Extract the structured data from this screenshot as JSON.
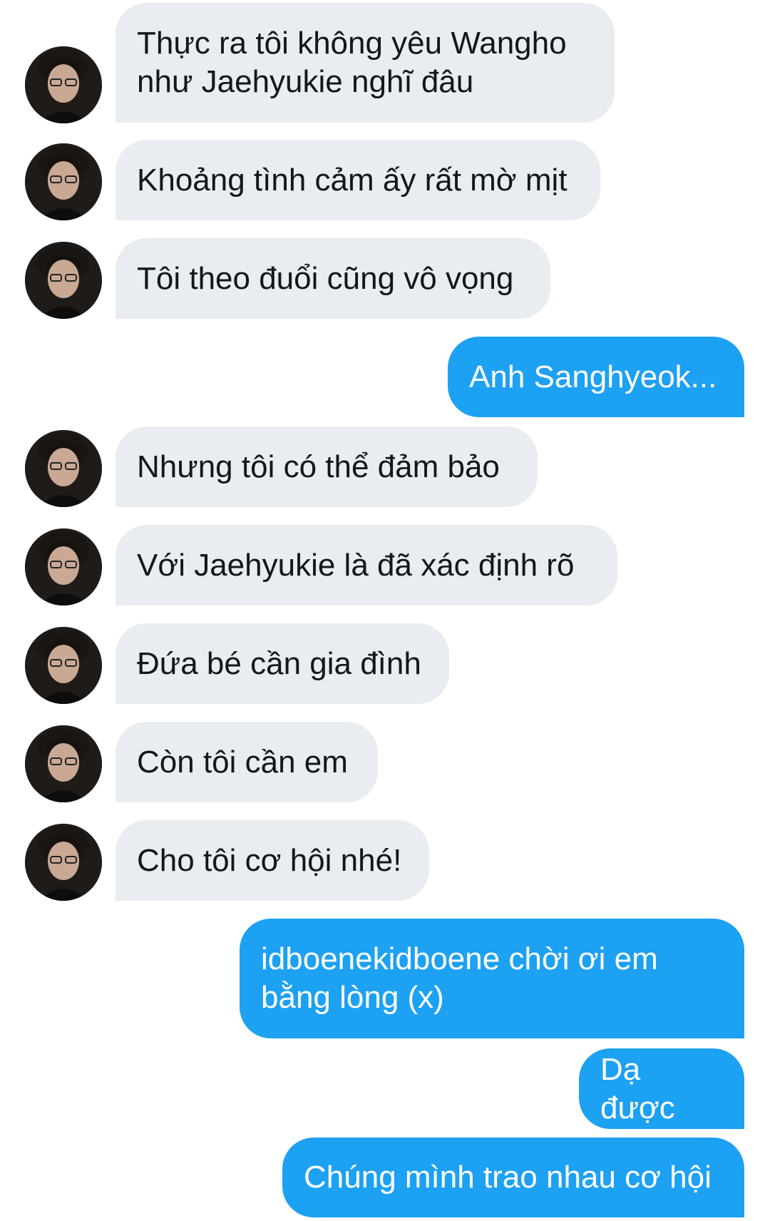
{
  "conversation": {
    "messages": [
      {
        "side": "in",
        "text": "Thực ra tôi không yêu Wangho\nnhư Jaehyukie nghĩ đâu"
      },
      {
        "side": "in",
        "text": "Khoảng tình cảm ấy rất mờ mịt"
      },
      {
        "side": "in",
        "text": "Tôi theo đuổi cũng vô vọng"
      },
      {
        "side": "out",
        "text": "Anh Sanghyeok..."
      },
      {
        "side": "in",
        "text": "Nhưng tôi có thể đảm bảo"
      },
      {
        "side": "in",
        "text": "Với Jaehyukie là đã xác định rõ"
      },
      {
        "side": "in",
        "text": "Đứa bé cần gia đình"
      },
      {
        "side": "in",
        "text": "Còn tôi cần em"
      },
      {
        "side": "in",
        "text": "Cho tôi cơ hội nhé!"
      },
      {
        "side": "out",
        "text": "idboenekidboene chời ơi em\nbằng lòng (x)"
      },
      {
        "side": "out",
        "text": "Dạ được"
      },
      {
        "side": "out",
        "text": "Chúng mình trao nhau cơ hội"
      }
    ]
  },
  "colors": {
    "incoming_bubble": "#e9ecf0",
    "outgoing_bubble": "#1da1f2",
    "incoming_text": "#14171a",
    "outgoing_text": "#ffffff"
  },
  "icons": {
    "sender_avatar": "avatar"
  }
}
